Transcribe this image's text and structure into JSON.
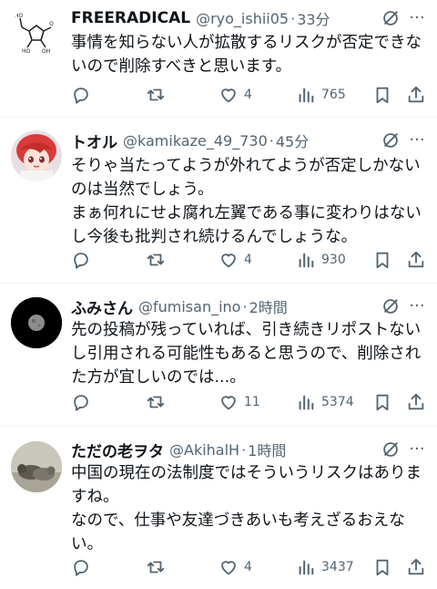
{
  "tweets": [
    {
      "name": "FREERADICAL",
      "handle": "@ryo_ishii05",
      "time": "33分",
      "text": "事情を知らない人が拡散するリスクが否定できないので削除すべきと思います。",
      "likes": "4",
      "views": "765"
    },
    {
      "name": "トオル",
      "handle": "@kamikaze_49_730",
      "time": "45分",
      "text": "そりゃ当たってようが外れてようが否定しかないのは当然でしょう。\nまぁ何れにせよ腐れ左翼である事に変わりはないし今後も批判され続けるんでしょうな。",
      "likes": "4",
      "views": "930"
    },
    {
      "name": "ふみさん",
      "handle": "@fumisan_ino",
      "time": "2時間",
      "text": "先の投稿が残っていれば、引き続きリポストないし引用される可能性もあると思うので、削除された方が宜しいのでは...。",
      "likes": "11",
      "views": "5374"
    },
    {
      "name": "ただの老ヲタ",
      "handle": "@AkihalH",
      "time": "1時間",
      "text": "中国の現在の法制度ではそういうリスクはありますね。\nなので、仕事や友達づきあいも考えざるおえない。",
      "likes": "4",
      "views": "3437"
    }
  ],
  "separator": "·",
  "more_glyph": "···",
  "colors": {
    "secondary": "#536471",
    "border": "#eff3f4",
    "text": "#0f1419"
  }
}
